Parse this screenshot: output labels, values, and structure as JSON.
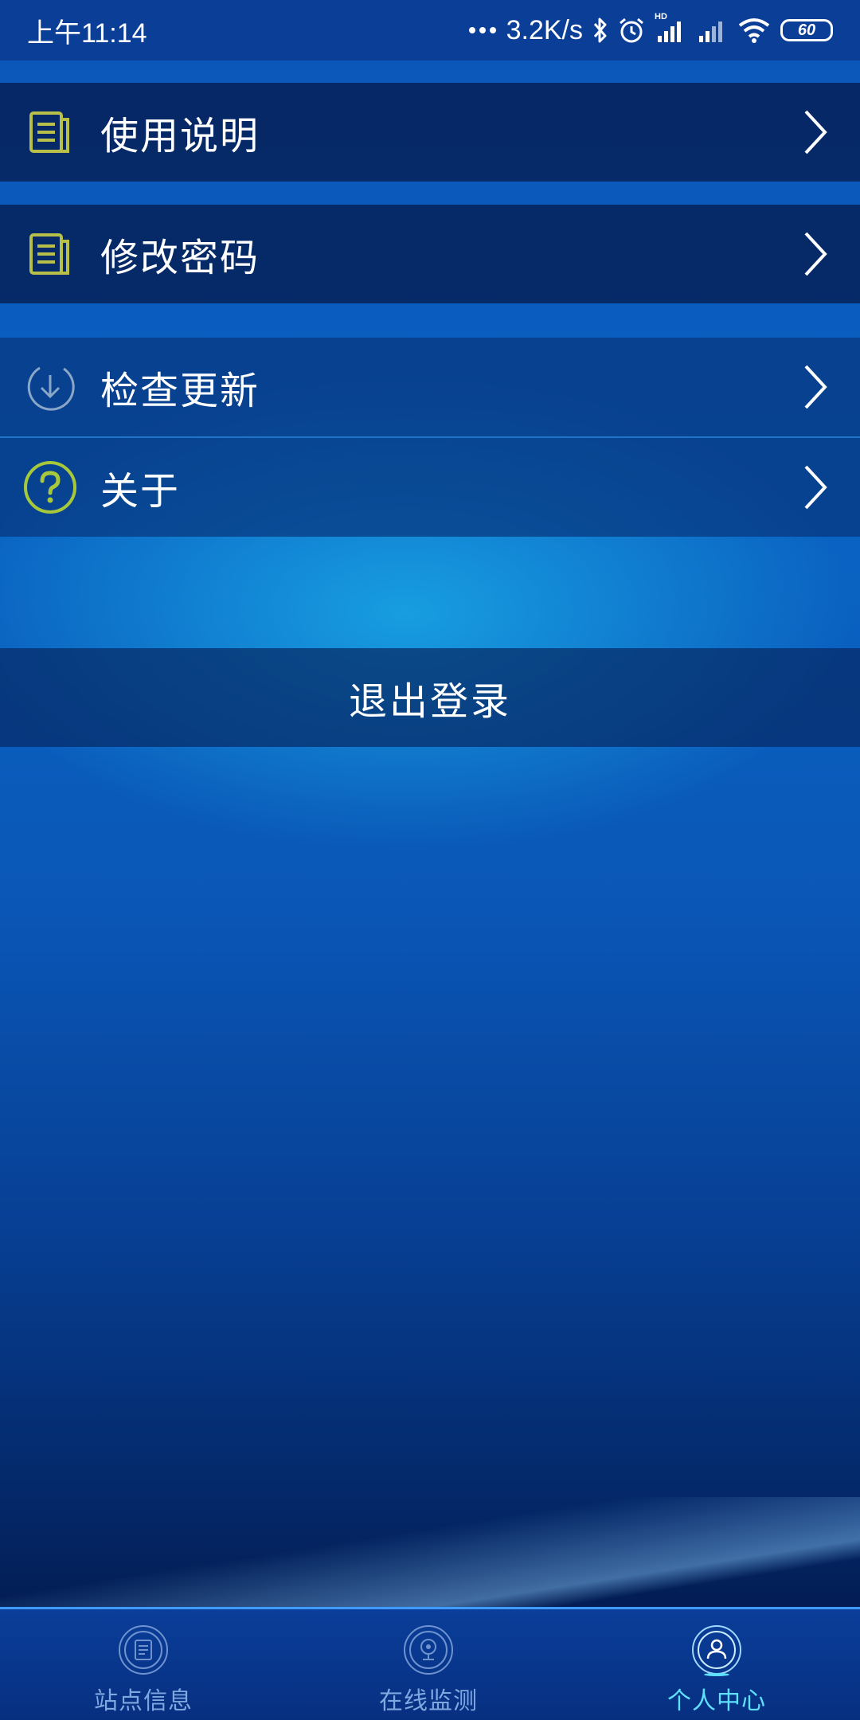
{
  "status_bar": {
    "time": "上午11:14",
    "network_speed": "3.2K/s",
    "hd_label": "HD",
    "battery": "60",
    "icons": [
      "more-dots-icon",
      "bluetooth-icon",
      "alarm-icon",
      "signal-hd-icon",
      "signal-icon",
      "wifi-icon",
      "battery-icon"
    ]
  },
  "menu": {
    "items": [
      {
        "label": "使用说明",
        "icon": "document-icon"
      },
      {
        "label": "修改密码",
        "icon": "document-icon"
      },
      {
        "label": "检查更新",
        "icon": "update-download-icon"
      },
      {
        "label": "关于",
        "icon": "question-mark-icon"
      }
    ]
  },
  "logout_label": "退出登录",
  "tabbar": {
    "tabs": [
      {
        "label": "站点信息",
        "icon": "station-info-icon",
        "active": false
      },
      {
        "label": "在线监测",
        "icon": "camera-monitor-icon",
        "active": false
      },
      {
        "label": "个人中心",
        "icon": "user-profile-icon",
        "active": true
      }
    ]
  },
  "colors": {
    "accent_active_tab": "#5fe0ff",
    "inactive_tab": "#7fa8e0",
    "doc_icon": "#b8c04a",
    "question_icon": "#a8c83c"
  }
}
